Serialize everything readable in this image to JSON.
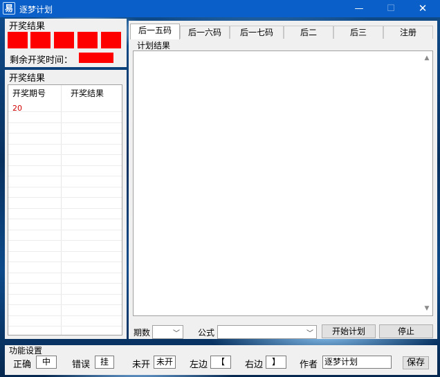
{
  "window": {
    "title": "逐梦计划",
    "app_icon": "app-logo-icon",
    "controls": {
      "minimize": "—",
      "maximize": "☐",
      "close": "✕"
    }
  },
  "results_panel": {
    "legend": "开奖结果",
    "boxes": [
      "",
      "",
      "",
      "",
      ""
    ],
    "box_color": "#ff0000",
    "remaining_time_label": "剩余开奖时间：",
    "remaining_time_value": ""
  },
  "history_panel": {
    "legend": "开奖结果",
    "columns": [
      "开奖期号",
      "开奖结果"
    ],
    "rows": [
      {
        "issue": "20",
        "result": ""
      }
    ]
  },
  "tabs": [
    {
      "label": "后一五码",
      "active": true
    },
    {
      "label": "后一六码",
      "active": false
    },
    {
      "label": "后一七码",
      "active": false
    },
    {
      "label": "后二",
      "active": false
    },
    {
      "label": "后三",
      "active": false
    },
    {
      "label": "注册",
      "active": false
    }
  ],
  "plan_panel": {
    "legend": "计划结果",
    "content": ""
  },
  "controls_row": {
    "periods_label": "期数",
    "periods_value": "",
    "formula_label": "公式",
    "formula_value": "",
    "start_button": "开始计划",
    "stop_button": "停止"
  },
  "function_settings": {
    "legend": "功能设置",
    "correct_label": "正确",
    "correct_value": "中",
    "wrong_label": "错误",
    "wrong_value": "挂",
    "unopened_label": "未开",
    "unopened_value": "未开",
    "left_label": "左边",
    "left_value": "【",
    "right_label": "右边",
    "right_value": "】",
    "author_label": "作者",
    "author_value": "逐梦计划",
    "save_button": "保存"
  }
}
